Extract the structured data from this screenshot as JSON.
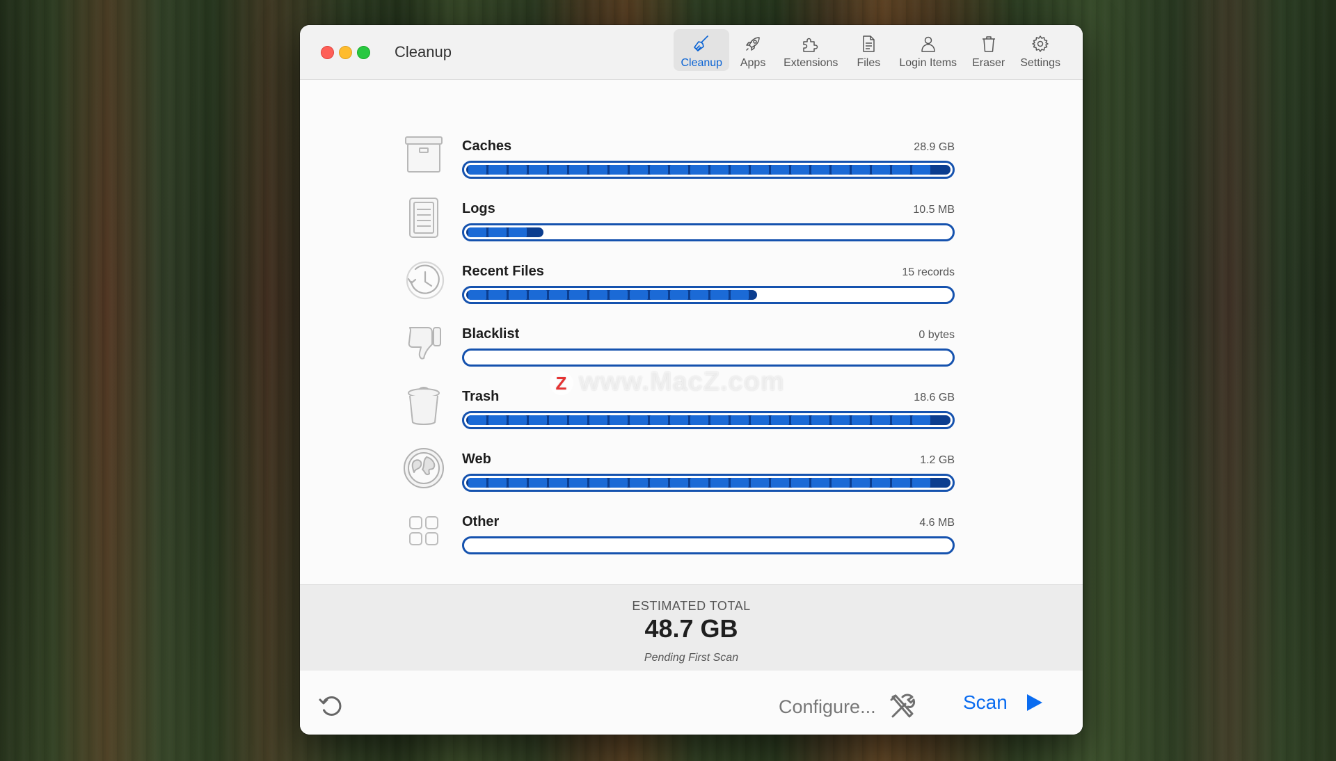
{
  "window": {
    "title": "Cleanup"
  },
  "tabs": [
    {
      "label": "Cleanup",
      "icon": "broom-icon",
      "active": true
    },
    {
      "label": "Apps",
      "icon": "rocket-icon",
      "active": false
    },
    {
      "label": "Extensions",
      "icon": "puzzle-icon",
      "active": false
    },
    {
      "label": "Files",
      "icon": "document-icon",
      "active": false
    },
    {
      "label": "Login Items",
      "icon": "user-icon",
      "active": false
    },
    {
      "label": "Eraser",
      "icon": "trash-icon",
      "active": false
    },
    {
      "label": "Settings",
      "icon": "gear-icon",
      "active": false
    }
  ],
  "categories": [
    {
      "label": "Caches",
      "value": "28.9 GB",
      "icon": "archive-box-icon",
      "fill_fraction": 1.0
    },
    {
      "label": "Logs",
      "value": "10.5 MB",
      "icon": "log-document-icon",
      "fill_fraction": 0.16
    },
    {
      "label": "Recent Files",
      "value": "15 records",
      "icon": "clock-history-icon",
      "fill_fraction": 0.6
    },
    {
      "label": "Blacklist",
      "value": "0 bytes",
      "icon": "thumbs-down-icon",
      "fill_fraction": 0.0
    },
    {
      "label": "Trash",
      "value": "18.6 GB",
      "icon": "trash-can-icon",
      "fill_fraction": 1.0
    },
    {
      "label": "Web",
      "value": "1.2 GB",
      "icon": "globe-icon",
      "fill_fraction": 1.0
    },
    {
      "label": "Other",
      "value": "4.6 MB",
      "icon": "grid-icon",
      "fill_fraction": 0.0
    }
  ],
  "summary": {
    "label": "ESTIMATED TOTAL",
    "total": "48.7 GB",
    "status": "Pending First Scan"
  },
  "footer": {
    "configure_label": "Configure...",
    "scan_label": "Scan"
  },
  "watermark": {
    "text": "www.MacZ.com",
    "logo_letter": "Z"
  },
  "colors": {
    "accent": "#0a6cf0",
    "bar_border": "#1552ae",
    "bar_fill": "#1b6ad6"
  }
}
